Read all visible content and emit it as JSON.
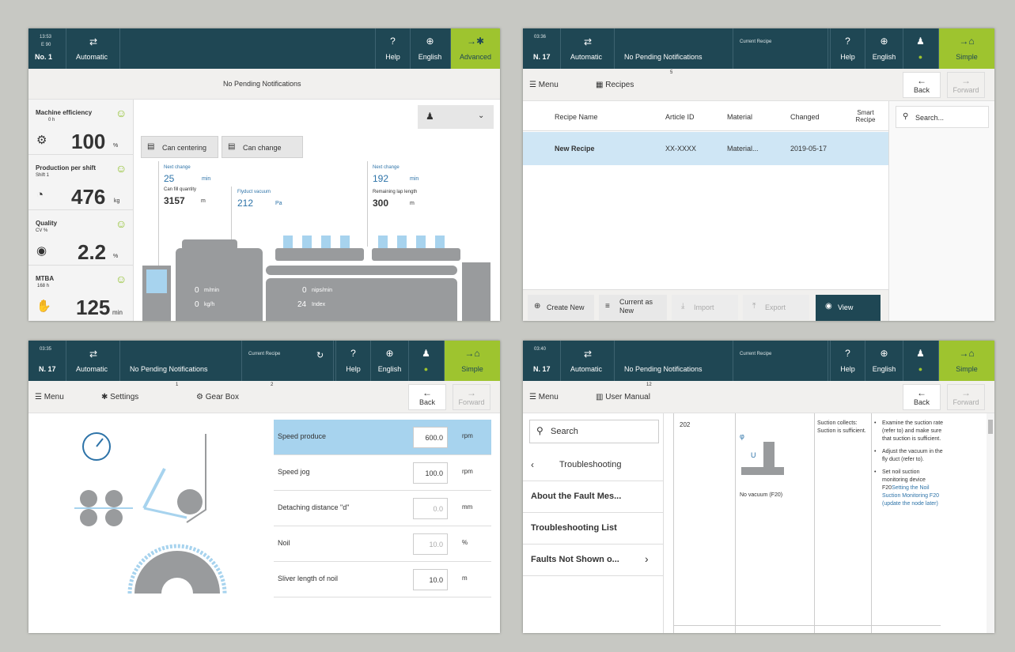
{
  "p1": {
    "time": "13:53",
    "unit": "E 90",
    "no": "No. 1",
    "mode": "Automatic",
    "help": "Help",
    "lang": "English",
    "adv": "Advanced",
    "notif": "No Pending Notifications",
    "kpis": [
      {
        "title": "Machine efficiency",
        "sub": "0 h",
        "value": "100",
        "unit": "%"
      },
      {
        "title": "Production per shift",
        "sub": "Shift 1",
        "value": "476",
        "unit": "kg"
      },
      {
        "title": "Quality",
        "sub": "CV %",
        "value": "2.2",
        "unit": "%"
      },
      {
        "title": "MTBA",
        "sub": "168 h",
        "value": "125",
        "unit": "min"
      }
    ],
    "btn_center": "Can centering",
    "btn_change": "Can change",
    "nc1_lbl": "Next change",
    "nc1_val": "25",
    "nc1_unit": "min",
    "cfq_lbl": "Can fill quantity",
    "cfq_val": "3157",
    "cfq_unit": "m",
    "fv_lbl": "Flyduct vacuum",
    "fv_val": "212",
    "fv_unit": "Pa",
    "nc2_lbl": "Next change",
    "nc2_val": "192",
    "nc2_unit": "min",
    "rll_lbl": "Remaining lap length",
    "rll_val": "300",
    "rll_unit": "m",
    "m1_val": "0",
    "m1_unit": "m/min",
    "m2_val": "0",
    "m2_unit": "kg/h",
    "m3_val": "0",
    "m3_unit": "nips/min",
    "m4_val": "24",
    "m4_unit": "Index"
  },
  "p2": {
    "time": "03:36",
    "no": "N. 17",
    "mode": "Automatic",
    "notif": "No Pending Notifications",
    "cur": "Current Recipe",
    "help": "Help",
    "lang": "English",
    "simple": "Simple",
    "menu": "Menu",
    "crumb": "Recipes",
    "crumb_num": "5",
    "back": "Back",
    "fwd": "Forward",
    "cols": [
      "Recipe Name",
      "Article ID",
      "Material",
      "Changed",
      "Smart Recipe"
    ],
    "row": [
      "New Recipe",
      "XX-XXXX",
      "Material...",
      "2019-05-17"
    ],
    "search": "Search...",
    "btns": [
      "Create New",
      "Current as New",
      "Import",
      "Export",
      "View"
    ]
  },
  "p3": {
    "time": "03:35",
    "no": "N. 17",
    "mode": "Automatic",
    "notif": "No Pending Notifications",
    "cur": "Current Recipe",
    "help": "Help",
    "lang": "English",
    "simple": "Simple",
    "menu": "Menu",
    "crumb1": "Settings",
    "crumb1_num": "1",
    "crumb2": "Gear Box",
    "crumb2_num": "2",
    "back": "Back",
    "fwd": "Forward",
    "rows": [
      {
        "name": "Speed produce",
        "val": "600.0",
        "unit": "rpm"
      },
      {
        "name": "Speed jog",
        "val": "100.0",
        "unit": "rpm"
      },
      {
        "name": "Detaching distance \"d\"",
        "val": "0.0",
        "unit": "mm"
      },
      {
        "name": "Noil",
        "val": "10.0",
        "unit": "%"
      },
      {
        "name": "Sliver length of noil",
        "val": "10.0",
        "unit": "m"
      }
    ]
  },
  "p4": {
    "time": "03:40",
    "no": "N. 17",
    "mode": "Automatic",
    "notif": "No Pending Notifications",
    "cur": "Current Recipe",
    "help": "Help",
    "lang": "English",
    "simple": "Simple",
    "menu": "Menu",
    "crumb": "User Manual",
    "crumb_num": "12",
    "back": "Back",
    "fwd": "Forward",
    "search": "Search",
    "ts": "Troubleshooting",
    "items": [
      "About the Fault Mes...",
      "Troubleshooting List",
      "Faults Not Shown o..."
    ],
    "code": "202",
    "fig_cap": "No vacuum (F20)",
    "cause": "Suction collects: Suction is sufficient.",
    "b1": "Examine the suction rate (refer to) and make sure that suction is sufficient.",
    "b2": "Adjust the vacuum in the fly duct (refer to).",
    "b3a": "Set noil suction monitoring device F20",
    "b3b": "Setting the Noil Suction Monitoring F20 (update the node later)"
  }
}
